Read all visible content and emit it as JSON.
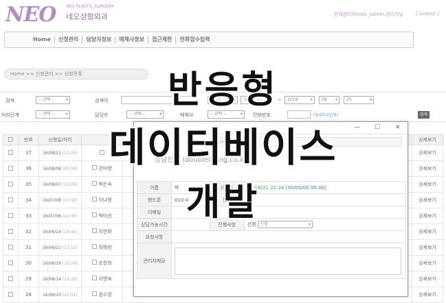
{
  "header": {
    "logo": "NEO",
    "logo_en": "NEO PLASTIC SURGERY",
    "logo_kr": "네오성형외과",
    "admin_text": "전체관리자(neo_admin,관리자님",
    "logout": "[ Logout ]"
  },
  "nav": {
    "items": [
      "Home",
      "신청관리",
      "담당자정보",
      "매체사정보",
      "접근제한",
      "전화접수입력"
    ]
  },
  "breadcrumb": "Home >> 신청관리 >> 신청목록",
  "filter": {
    "search_label": "검색",
    "search_select": "-- 선택 --",
    "keyword_label": "검색어",
    "date_from_year": "2016",
    "date_from_month": "08",
    "date_tilde": "~",
    "date_to_year": "2016",
    "date_to_month": "08",
    "date_to_day": "25",
    "status_label": "처리단계",
    "status_select": "-- 선택 --",
    "manager_label": "담당자",
    "manager_select": "-- 선택 --",
    "media_label": "매체사",
    "media_select": "-- 선택 --",
    "phone_label": "전화번호",
    "digits_link": "[뒷4자리입력]",
    "search_button": "검색"
  },
  "table": {
    "headers": [
      "",
      "번호",
      "신청일/처리",
      "",
      "",
      "",
      "",
      "",
      "",
      "",
      "",
      "상세보기"
    ],
    "rows": [
      {
        "no": "37",
        "date": "16/08/21",
        "time": "(22:24)",
        "name": "",
        "detail": "상세보기"
      },
      {
        "no": "36",
        "date": "16/08/08",
        "time": "(00:59)",
        "name": "강미향",
        "detail": "상세보기"
      },
      {
        "no": "35",
        "date": "16/08/07",
        "time": "(22:00)",
        "name": "박은숙",
        "detail": "상세보기"
      },
      {
        "no": "34",
        "date": "16/07/08",
        "time": "(11:43)",
        "name": "이나영",
        "detail": "상세보기"
      },
      {
        "no": "33",
        "date": "16/07/06",
        "time": "(22:40)",
        "name": "박미선",
        "detail": "상세보기"
      },
      {
        "no": "32",
        "date": "16/06/24",
        "time": "(14:06)",
        "name": "이연화",
        "detail": "상세보기"
      },
      {
        "no": "31",
        "date": "16/06/21",
        "time": "(17:12)",
        "name": "최해란",
        "detail": "상세보기"
      },
      {
        "no": "30",
        "date": "16/06/19",
        "time": "(10:24)",
        "name": "조한희",
        "detail": "상세보기"
      },
      {
        "no": "29",
        "date": "16/06/14",
        "time": "(14:20)",
        "name": "이영숙",
        "detail": "상세보기"
      },
      {
        "no": "28",
        "date": "16/06/10",
        "time": "(21:51)",
        "name": "정수정",
        "detail": "상세보기"
      }
    ]
  },
  "popup": {
    "url_fragment": "mode=newss",
    "heading": "상담신청 (doublelifting.co.kr)",
    "name_label": "이름",
    "name_value": "박",
    "date_label": "신청일",
    "date_value": "16/08/21 22:24",
    "date_extra": "[00/00/00 00:00]",
    "mobile_label": "핸드폰",
    "mobile_value": "010-4",
    "phone_label": "전화",
    "email_label": "이메일",
    "time_label": "상담가능시간",
    "progress_label": "진행사항",
    "progress_prefix": "선행",
    "progress_select": "신청",
    "request_label": "요청사항",
    "memo_label": "관리자메모"
  },
  "overlay": {
    "line1": "반응형",
    "line2": "데이터베이스",
    "line3": "개발"
  }
}
